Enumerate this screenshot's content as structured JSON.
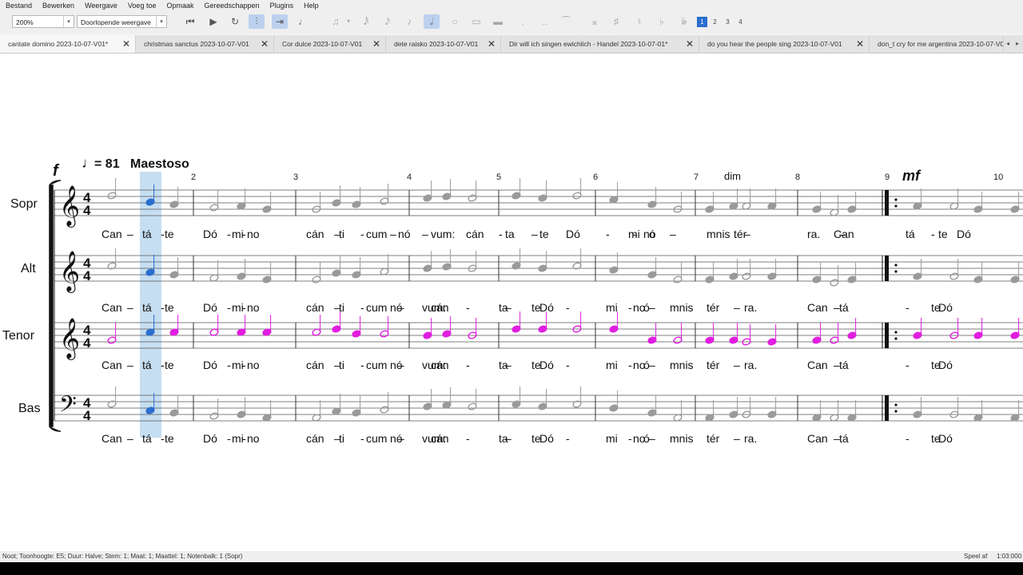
{
  "menu": [
    "Bestand",
    "Bewerken",
    "Weergave",
    "Voeg toe",
    "Opmaak",
    "Gereedschappen",
    "Plugins",
    "Help"
  ],
  "toolbar": {
    "zoom": "200%",
    "view_mode": "Doorlopende weergave",
    "voices": [
      "1",
      "2",
      "3",
      "4"
    ],
    "selected_voice": "1"
  },
  "tabs": [
    {
      "label": "cantate domino 2023-10-07-V01*",
      "active": true
    },
    {
      "label": "christmas sanctus 2023-10-07-V01",
      "active": false
    },
    {
      "label": "Cor dulce 2023-10-07-V01",
      "active": false
    },
    {
      "label": "dete raisko 2023-10-07-V01",
      "active": false
    },
    {
      "label": "Dir will ich singen ewichlich - Handel 2023-10-07-01*",
      "active": false
    },
    {
      "label": "do you hear the people sing 2023-10-07-V01",
      "active": false
    },
    {
      "label": "don_t cry for me argentina 2023-10-07-V0",
      "active": false
    }
  ],
  "score": {
    "dynamic_start": "f",
    "tempo_value": "= 81",
    "tempo_text": "Maestoso",
    "dim_text": "dim",
    "dynamic_mf": "mf",
    "time_signature": "4/4",
    "measure_numbers": [
      "2",
      "3",
      "4",
      "5",
      "6",
      "7",
      "8",
      "9",
      "10"
    ],
    "staves": [
      {
        "name": "Sopr",
        "clef": "treble",
        "color": "#9a9a9a"
      },
      {
        "name": "Alt",
        "clef": "treble",
        "color": "#9a9a9a"
      },
      {
        "name": "Tenor",
        "clef": "treble8",
        "color": "#e01ee0"
      },
      {
        "name": "Bas",
        "clef": "bass",
        "color": "#9a9a9a"
      }
    ],
    "lyrics": [
      "Can",
      "–",
      "tá",
      "-",
      "te",
      "Dó",
      "-",
      "mi",
      "-",
      "no",
      "cán",
      "–",
      "ti",
      "-",
      "cum",
      "–",
      "nó",
      "–",
      "vum:",
      "cán",
      "-",
      "ta",
      "–",
      "te",
      "Dó",
      "-",
      "mi",
      "-",
      "no",
      "ó",
      "–",
      "mnis",
      "tér",
      "–",
      "ra.",
      "Can",
      "–",
      "tá",
      "-",
      "te",
      "Dó"
    ],
    "lyrics_alt": [
      "Can",
      "–",
      "tá",
      "-",
      "te",
      "Dó",
      "-",
      "mi",
      "-",
      "no",
      "cán",
      "–",
      "ti",
      "-",
      "cum",
      "nó",
      "–",
      "vum:",
      "cán",
      "-",
      "ta",
      "–",
      "te",
      "Dó",
      "-",
      "mi",
      "-",
      "no",
      "ó",
      "–",
      "mnis",
      "tér",
      "–",
      "ra.",
      "Can",
      "–",
      "tá",
      "-",
      "te",
      "Dó"
    ]
  },
  "status": {
    "left": "Noot; Toonhoogte: E5; Duur: Halve; Stem: 1; Maat: 1; Maattel: 1; Notenbalk: 1 (Sopr)",
    "mode": "Speel af",
    "time": "1:03:000"
  },
  "colors": {
    "accent": "#2a6ecf",
    "tenor": "#e01ee0",
    "selection": "#bcd8ee",
    "notes": "#9a9a9a"
  }
}
